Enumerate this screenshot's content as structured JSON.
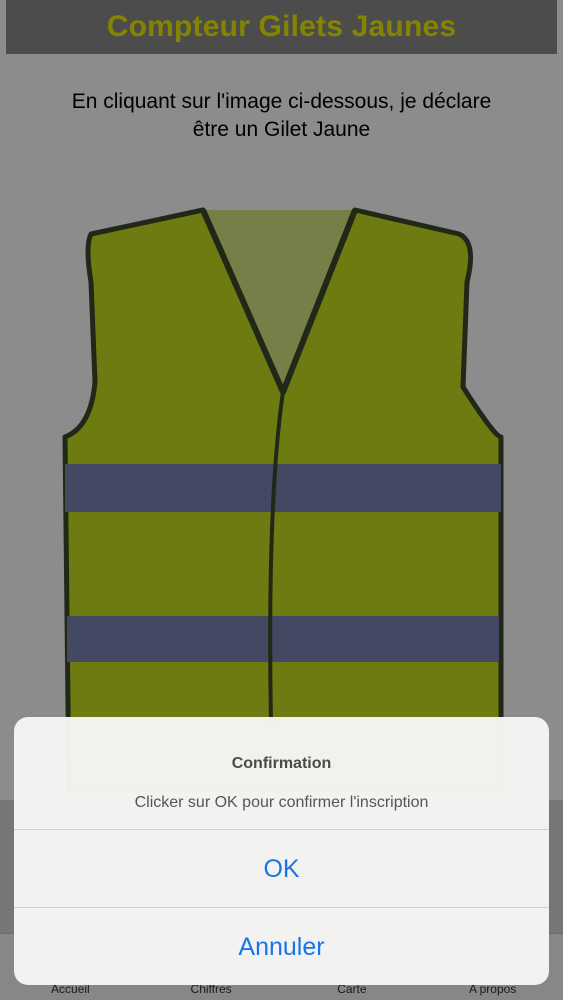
{
  "header": {
    "title": "Compteur Gilets Jaunes"
  },
  "main": {
    "instruction_line1": "En cliquant sur l'image ci-dessous, je déclare",
    "instruction_line2": "être un Gilet Jaune",
    "image_icon": "yellow-vest-icon"
  },
  "tabbar": {
    "items": [
      {
        "label": "Accueil"
      },
      {
        "label": "Chiffres"
      },
      {
        "label": "Carte"
      },
      {
        "label": "A propos"
      }
    ]
  },
  "alert": {
    "title": "Confirmation",
    "message": "Clicker sur OK pour confirmer l'inscription",
    "ok_label": "OK",
    "cancel_label": "Annuler"
  },
  "colors": {
    "header_bg": "#8a8a8a",
    "header_text": "#f2f000",
    "vest": "#c8e020",
    "reflective_band": "#7a86b4",
    "alert_button": "#1a73e8"
  }
}
